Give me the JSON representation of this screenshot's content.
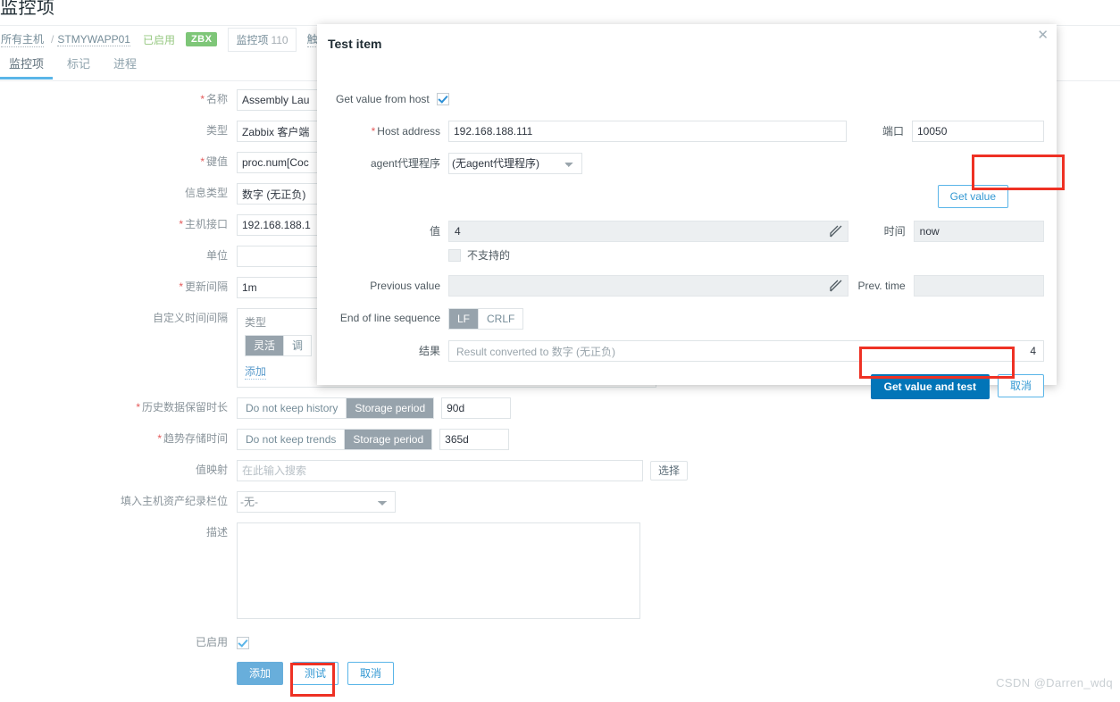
{
  "page": {
    "title": "监控项",
    "watermark": "CSDN @Darren_wdq"
  },
  "breadcrumb": {
    "all_hosts": "所有主机",
    "separator": "/",
    "host": "STMYWAPP01",
    "status": "已启用",
    "zbx_badge": "ZBX",
    "items_chip_label": "监控项",
    "items_chip_count": "110",
    "more": "触"
  },
  "tabs": [
    {
      "label": "监控项",
      "active": true
    },
    {
      "label": "标记",
      "active": false
    },
    {
      "label": "进程",
      "active": false
    }
  ],
  "form": {
    "name": {
      "label": "名称",
      "required": true,
      "value": "Assembly Lau"
    },
    "type": {
      "label": "类型",
      "required": false,
      "value": "Zabbix 客户端"
    },
    "key": {
      "label": "键值",
      "required": true,
      "value": "proc.num[Coc"
    },
    "info_type": {
      "label": "信息类型",
      "required": false,
      "value": "数字 (无正负)"
    },
    "host_interface": {
      "label": "主机接口",
      "required": true,
      "value": "192.168.188.1"
    },
    "units": {
      "label": "单位",
      "required": false,
      "value": ""
    },
    "update_interval": {
      "label": "更新间隔",
      "required": true,
      "value": "1m"
    },
    "custom_intervals": {
      "label": "自定义时间间隔",
      "col_type": "类型",
      "seg_flexible": "灵活",
      "seg_scheduling": "调",
      "add_link": "添加"
    },
    "history": {
      "label": "历史数据保留时长",
      "required": true,
      "opt_off": "Do not keep history",
      "opt_on": "Storage period",
      "value": "90d"
    },
    "trends": {
      "label": "趋势存储时间",
      "required": true,
      "opt_off": "Do not keep trends",
      "opt_on": "Storage period",
      "value": "365d"
    },
    "value_map": {
      "label": "值映射",
      "placeholder": "在此输入搜索",
      "value": "",
      "select_button": "选择"
    },
    "inventory_field": {
      "label": "填入主机资产纪录栏位",
      "value": "-无-"
    },
    "description": {
      "label": "描述",
      "value": ""
    },
    "enabled": {
      "label": "已启用",
      "checked": true
    },
    "buttons": {
      "add": "添加",
      "test": "测试",
      "cancel": "取消"
    }
  },
  "modal": {
    "title": "Test item",
    "close_icon": "close-icon",
    "get_value_from_host": {
      "label": "Get value from host",
      "checked": true
    },
    "host_address": {
      "label": "Host address",
      "required": true,
      "value": "192.168.188.111"
    },
    "port": {
      "label": "端口",
      "value": "10050"
    },
    "agent_proxy": {
      "label": "agent代理程序",
      "value": "(无agent代理程序)"
    },
    "get_value_button": "Get value",
    "value": {
      "label": "值",
      "value": "4"
    },
    "time": {
      "label": "时间",
      "value": "now"
    },
    "not_supported": {
      "label": "不支持的",
      "checked": false
    },
    "previous_value": {
      "label": "Previous value",
      "value": ""
    },
    "prev_time": {
      "label": "Prev. time",
      "value": ""
    },
    "eol": {
      "label": "End of line sequence",
      "options": [
        "LF",
        "CRLF"
      ],
      "selected": "LF"
    },
    "result": {
      "label": "结果",
      "placeholder": "Result converted to 数字 (无正负)",
      "value": "4"
    },
    "footer": {
      "submit": "Get value and test",
      "cancel": "取消"
    }
  },
  "colors": {
    "accent_blue": "#0275b8",
    "light_blue": "#5ab5e8",
    "highlight_red": "#ee3124",
    "zbx_green": "#7ec678",
    "muted_label": "#8a949b"
  }
}
